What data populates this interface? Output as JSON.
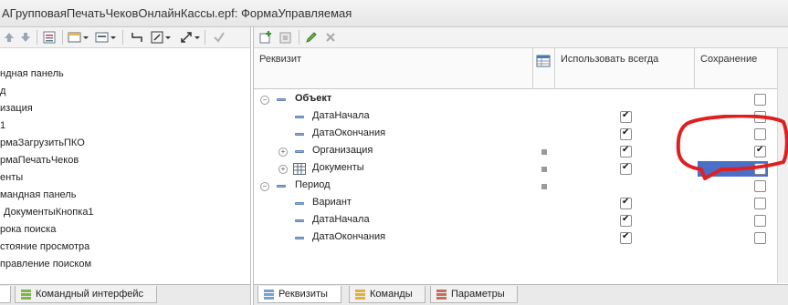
{
  "window": {
    "title": "АГрупповаяПечатьЧековОнлайнКассы.epf: ФормаУправляемая"
  },
  "left_tree": {
    "items": [
      "ндная панель",
      "д",
      "изация",
      "1",
      "рмаЗагрузитьПКО",
      "рмаПечатьЧеков",
      "енты",
      "мандная панель",
      "ДокументыКнопка1",
      "рока поиска",
      "стояние просмотра",
      "правление поиском"
    ],
    "bottom_tab": "Командный интерфейс"
  },
  "table": {
    "headers": {
      "requisite": "Реквизит",
      "use_always": "Использовать всегда",
      "save": "Сохранение"
    },
    "rows": [
      {
        "name": "Объект",
        "bold": true,
        "use_always": false,
        "save": false
      },
      {
        "name": "ДатаНачала",
        "use_always": true,
        "save": false
      },
      {
        "name": "ДатаОкончания",
        "use_always": true,
        "save": false
      },
      {
        "name": "Организация",
        "use_always": true,
        "save": true
      },
      {
        "name": "Документы",
        "use_always": true,
        "save": false
      },
      {
        "name": "Период",
        "use_always": false,
        "save": false
      },
      {
        "name": "Вариант",
        "use_always": true,
        "save": false
      },
      {
        "name": "ДатаНачала",
        "use_always": true,
        "save": false
      },
      {
        "name": "ДатаОкончания",
        "use_always": true,
        "save": false
      }
    ]
  },
  "right_tabs": {
    "requisites": "Реквизиты",
    "commands": "Команды",
    "parameters": "Параметры"
  },
  "colors": {
    "selection": "#4a6fc7",
    "annotation": "#e02020"
  }
}
